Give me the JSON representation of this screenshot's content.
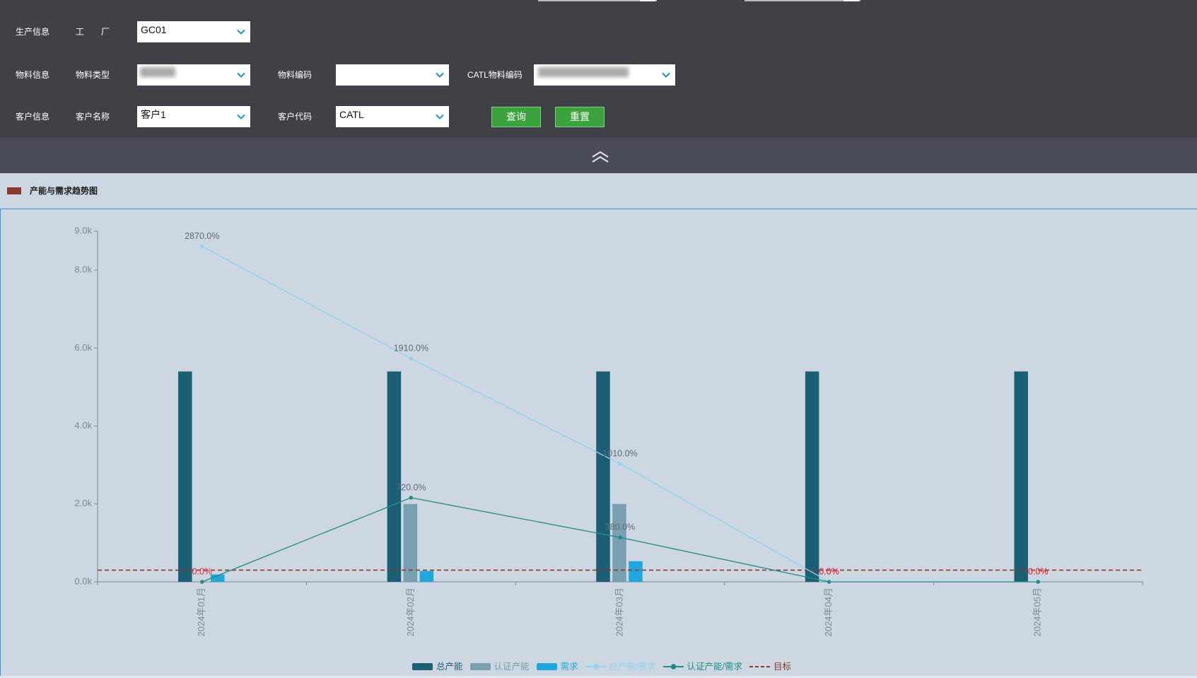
{
  "filters": {
    "dropdown_icon": "chevron-down-icon",
    "production": {
      "section_label": "生产信息",
      "factory": {
        "label": "工　厂",
        "value": "GC01"
      }
    },
    "material": {
      "section_label": "物料信息",
      "material_type": {
        "label": "物料类型",
        "value": ""
      },
      "material_code": {
        "label": "物料编码",
        "value": ""
      },
      "catl_material_code": {
        "label": "CATL物料编码",
        "value": ""
      }
    },
    "customer": {
      "section_label": "客户信息",
      "customer_name": {
        "label": "客户名称",
        "value": "客户1"
      },
      "customer_code": {
        "label": "客户代码",
        "value": "CATL"
      }
    },
    "actions": {
      "query_label": "查询",
      "reset_label": "重置"
    }
  },
  "collapse": {
    "icon": "double-chevron-up-icon"
  },
  "panel": {
    "marker_color": "#8b3a2a"
  },
  "chart_data": {
    "type": "bar",
    "title": "产能与需求趋势图",
    "categories": [
      "2024年01月",
      "2024年02月",
      "2024年03月",
      "2024年04月",
      "2024年05月"
    ],
    "ylim": [
      0,
      9000
    ],
    "y_ticks": [
      0,
      2000,
      4000,
      6000,
      8000,
      9000
    ],
    "y_tick_labels": [
      "0.0k",
      "2.0k",
      "4.0k",
      "6.0k",
      "8.0k",
      "9.0k"
    ],
    "y2lim": [
      0,
      3000
    ],
    "grid": false,
    "legend_position": "bottom",
    "axis_color": "#7f8a96",
    "tick_label_color": "#7f8893",
    "data_label_color": "#626a74",
    "alert_label_color": "#e8303a",
    "series": [
      {
        "name": "总产能",
        "type": "bar",
        "y_axis": "primary",
        "color": "#1b5f75",
        "values": [
          5400,
          5400,
          5400,
          5400,
          5400
        ]
      },
      {
        "name": "认证产能",
        "type": "bar",
        "y_axis": "primary",
        "color": "#79a0b1",
        "values": [
          0,
          2000,
          2000,
          0,
          0
        ]
      },
      {
        "name": "需求",
        "type": "bar",
        "y_axis": "primary",
        "color": "#1ea8dc",
        "values": [
          190,
          280,
          530,
          0,
          0
        ]
      },
      {
        "name": "总产能/需求",
        "type": "line",
        "y_axis": "secondary",
        "color": "#8fd3f1",
        "values": [
          2870,
          1910,
          1010,
          0,
          0
        ],
        "labels": [
          "2870.0%",
          "1910.0%",
          "1010.0%",
          "0.0%",
          "0.0%"
        ]
      },
      {
        "name": "认证产能/需求",
        "type": "line",
        "y_axis": "secondary",
        "color": "#1e8f86",
        "values": [
          0,
          720,
          380,
          0,
          0
        ],
        "labels": [
          "0.0%",
          "720.0%",
          "380.0%",
          "0.0%",
          "0.0%"
        ]
      },
      {
        "name": "目标",
        "type": "line",
        "style": "dashed",
        "y_axis": "secondary",
        "color": "#8b3a2a",
        "values": [
          100,
          100,
          100,
          100,
          100
        ]
      }
    ]
  }
}
